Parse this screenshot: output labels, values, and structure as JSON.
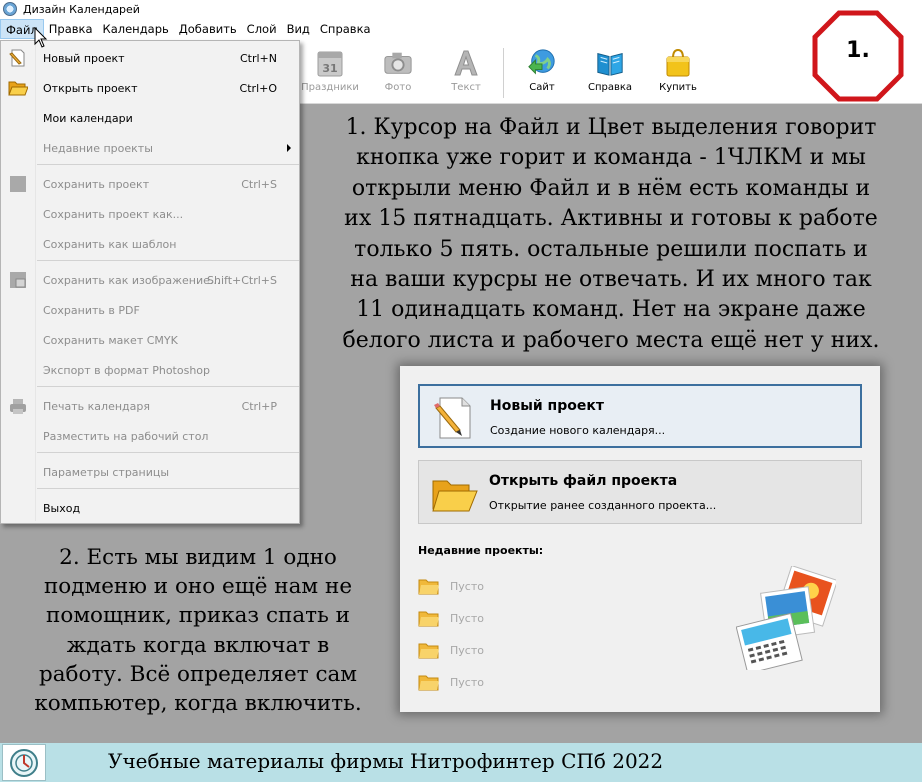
{
  "window": {
    "title": "Дизайн Календарей"
  },
  "menubar": {
    "items": [
      "Файл",
      "Правка",
      "Календарь",
      "Добавить",
      "Слой",
      "Вид",
      "Справка"
    ],
    "active": "Файл"
  },
  "toolbar": {
    "buttons": [
      {
        "label": "Праздники",
        "icon": "calendar-31-icon",
        "enabled": false
      },
      {
        "label": "Фото",
        "icon": "camera-icon",
        "enabled": false
      },
      {
        "label": "Текст",
        "icon": "text-a-icon",
        "enabled": false
      },
      {
        "label": "Сайт",
        "icon": "globe-arrow-icon",
        "enabled": true
      },
      {
        "label": "Справка",
        "icon": "book-icon",
        "enabled": true
      },
      {
        "label": "Купить",
        "icon": "shopping-bag-icon",
        "enabled": true
      }
    ]
  },
  "file_menu": {
    "items": [
      {
        "label": "Новый проект",
        "shortcut": "Ctrl+N",
        "enabled": true,
        "icon": "new-doc-pencil-icon"
      },
      {
        "label": "Открыть проект",
        "shortcut": "Ctrl+O",
        "enabled": true,
        "icon": "folder-icon"
      },
      {
        "label": "Мои календари",
        "shortcut": "",
        "enabled": true,
        "icon": ""
      },
      {
        "label": "Недавние проекты",
        "shortcut": "",
        "enabled": false,
        "icon": "",
        "submenu": true
      },
      {
        "label": "Сохранить проект",
        "shortcut": "Ctrl+S",
        "enabled": false,
        "icon": "save-icon"
      },
      {
        "label": "Сохранить проект как...",
        "shortcut": "",
        "enabled": false,
        "icon": ""
      },
      {
        "label": "Сохранить как шаблон",
        "shortcut": "",
        "enabled": false,
        "icon": ""
      },
      {
        "label": "Сохранить как изображение...",
        "shortcut": "Shift+Ctrl+S",
        "enabled": false,
        "icon": "save-image-icon"
      },
      {
        "label": "Сохранить в PDF",
        "shortcut": "",
        "enabled": false,
        "icon": ""
      },
      {
        "label": "Сохранить макет CMYK",
        "shortcut": "",
        "enabled": false,
        "icon": ""
      },
      {
        "label": "Экспорт в формат Photoshop",
        "shortcut": "",
        "enabled": false,
        "icon": ""
      },
      {
        "label": "Печать календаря",
        "shortcut": "Ctrl+P",
        "enabled": false,
        "icon": "printer-icon"
      },
      {
        "label": "Разместить на рабочий стол",
        "shortcut": "",
        "enabled": false,
        "icon": ""
      },
      {
        "label": "Параметры страницы",
        "shortcut": "",
        "enabled": false,
        "icon": ""
      },
      {
        "label": "Выход",
        "shortcut": "",
        "enabled": true,
        "icon": ""
      }
    ]
  },
  "badge": {
    "text": "1.",
    "color": "#d0161b"
  },
  "note1": {
    "lines": [
      "1. Курсор на Файл и Цвет выделения говорит",
      "кнопка уже горит и команда - 1ЧЛКМ и мы",
      "открыли меню Файл и в нём есть команды и",
      "их 15 пятнадцать. Активны и готовы к работе",
      "только 5 пять. остальные решили поспать и",
      "на ваши курсры не отвечать. И их много так",
      "11 одинадцать команд. Нет на экране даже",
      "белого листа и рабочего места ещё нет у них."
    ]
  },
  "note2": {
    "lines": [
      "2. Есть мы видим 1 одно",
      "подменю и оно ещё нам не",
      "помощник, приказ спать и",
      "ждать когда включат в",
      "работу. Всё определяет сам",
      "компьютер, когда включить."
    ]
  },
  "start_dialog": {
    "new_project": {
      "title": "Новый проект",
      "subtitle": "Создание нового календаря..."
    },
    "open_project": {
      "title": "Открыть файл проекта",
      "subtitle": "Открытие ранее созданного проекта..."
    },
    "recent_title": "Недавние проекты:",
    "recent_items": [
      "Пусто",
      "Пусто",
      "Пусто",
      "Пусто"
    ]
  },
  "footer": {
    "text": "Учебные материалы фирмы Нитрофинтер СПб 2022"
  },
  "colors": {
    "background": "#a3a3a3",
    "menu_highlight": "#cce4f7",
    "dialog_primary_border": "#3c6f9e",
    "footer_bg": "#b9e0e6"
  }
}
